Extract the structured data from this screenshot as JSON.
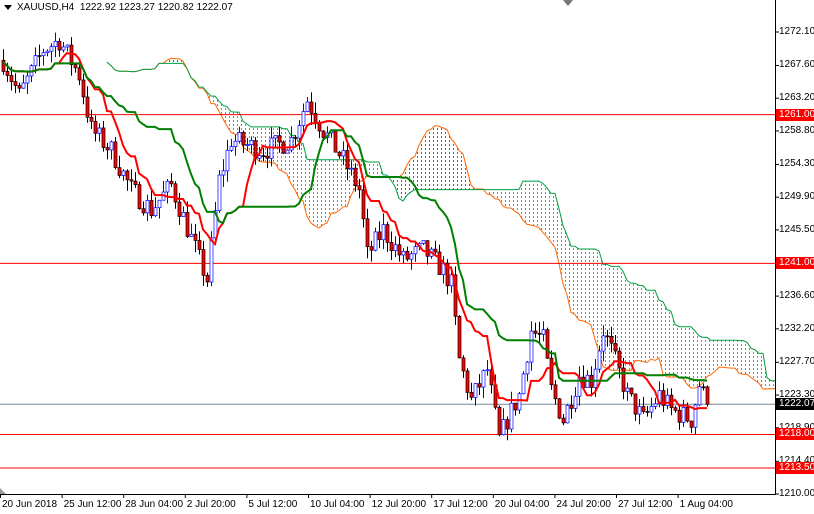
{
  "header": {
    "symbol": "XAUUSD,H4",
    "open": "1222.92",
    "high": "1223.27",
    "low": "1220.82",
    "close": "1222.07"
  },
  "price_axis": [
    "1272.10",
    "1267.60",
    "1263.20",
    "1258.80",
    "1254.30",
    "1249.90",
    "1245.50",
    "1236.60",
    "1232.20",
    "1227.70",
    "1223.30",
    "1218.90",
    "1214.40",
    "1210.00"
  ],
  "time_axis": [
    "20 Jun 2018",
    "25 Jun 12:00",
    "28 Jun 04:00",
    "2 Jul 20:00",
    "5 Jul 12:00",
    "10 Jul 04:00",
    "12 Jul 20:00",
    "17 Jul 12:00",
    "20 Jul 04:00",
    "24 Jul 20:00",
    "27 Jul 12:00",
    "1 Aug 04:00"
  ],
  "levels": [
    {
      "value": 1261.0,
      "label": "1261.00",
      "color": "#ff0000"
    },
    {
      "value": 1241.0,
      "label": "1241.00",
      "color": "#ff0000"
    },
    {
      "value": 1218.0,
      "label": "1218.00",
      "color": "#ff0000"
    },
    {
      "value": 1213.5,
      "label": "1213.50",
      "color": "#ff0000"
    }
  ],
  "bid": {
    "value": 1222.07,
    "label": "1222.07",
    "color": "#000000",
    "line_color": "#778899"
  },
  "colors": {
    "bull": "#0000ff",
    "bear_body": "#ff0000",
    "bear_outline": "#000000",
    "tenkan": "#ff0000",
    "kijun": "#008000",
    "cloud_bear": "#ff6600",
    "cloud_bull": "#00a040"
  },
  "chart_data": {
    "type": "candlestick",
    "symbol": "XAUUSD",
    "timeframe": "H4",
    "ylim": [
      1210.0,
      1272.1
    ],
    "indicator": "Ichimoku (9,26,52)",
    "price_path": [
      [
        0,
        1268.3
      ],
      [
        4,
        1263.6
      ],
      [
        10,
        1269.7
      ],
      [
        14,
        1271.0
      ],
      [
        19,
        1266.3
      ],
      [
        22,
        1259.0
      ],
      [
        27,
        1256.2
      ],
      [
        32,
        1250.9
      ],
      [
        37,
        1248.2
      ],
      [
        42,
        1251.5
      ],
      [
        49,
        1241.5
      ],
      [
        51,
        1238.8
      ],
      [
        54,
        1252.2
      ],
      [
        57,
        1257.6
      ],
      [
        65,
        1256.2
      ],
      [
        72,
        1257.6
      ],
      [
        76,
        1263.0
      ],
      [
        80,
        1258.9
      ],
      [
        85,
        1254.9
      ],
      [
        89,
        1250.9
      ],
      [
        91,
        1242.1
      ],
      [
        95,
        1245.5
      ],
      [
        100,
        1241.5
      ],
      [
        105,
        1242.8
      ],
      [
        110,
        1240.1
      ],
      [
        112,
        1238.1
      ],
      [
        114,
        1228.0
      ],
      [
        117,
        1222.6
      ],
      [
        121,
        1226.7
      ],
      [
        124,
        1217.3
      ],
      [
        126,
        1220.0
      ],
      [
        129,
        1223.3
      ],
      [
        132,
        1232.0
      ],
      [
        135,
        1230.7
      ],
      [
        137,
        1224.0
      ],
      [
        140,
        1220.0
      ],
      [
        144,
        1226.0
      ],
      [
        147,
        1225.3
      ],
      [
        150,
        1232.0
      ],
      [
        152,
        1229.3
      ],
      [
        156,
        1223.3
      ],
      [
        160,
        1220.0
      ],
      [
        164,
        1223.3
      ],
      [
        167,
        1221.3
      ],
      [
        172,
        1220.0
      ],
      [
        174,
        1224.7
      ],
      [
        176,
        1222.07
      ]
    ]
  }
}
